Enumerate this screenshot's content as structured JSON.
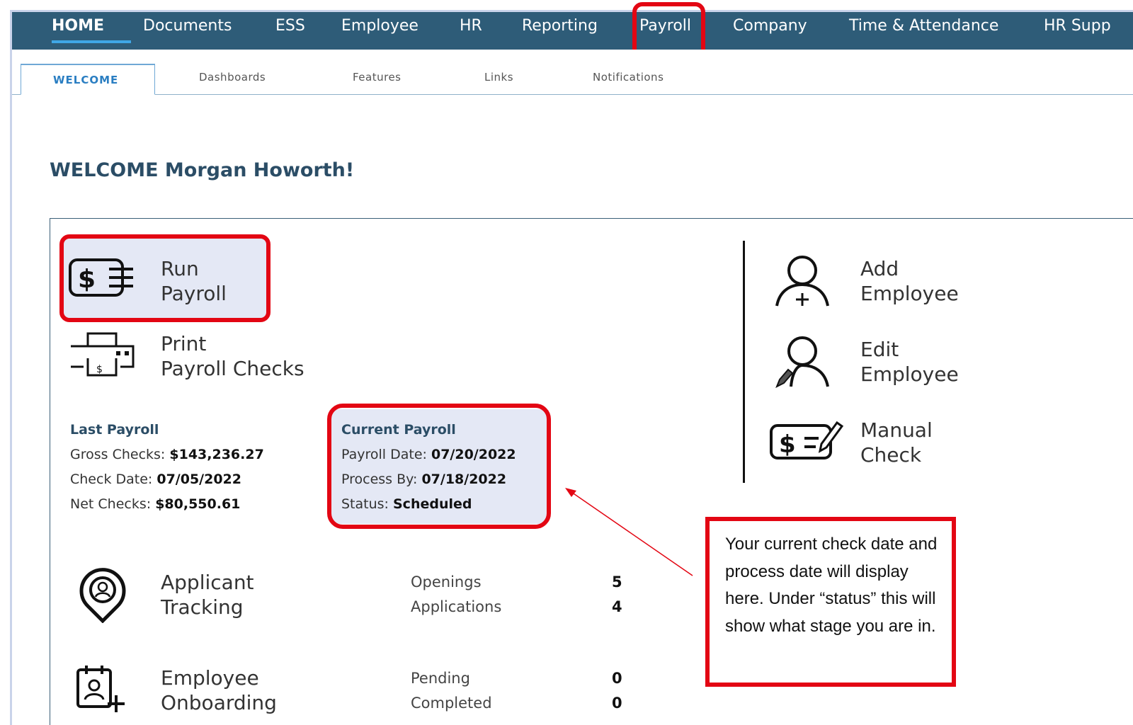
{
  "nav": {
    "items": [
      "HOME",
      "Documents",
      "ESS",
      "Employee",
      "HR",
      "Reporting",
      "Payroll",
      "Company",
      "Time & Attendance",
      "HR Supp"
    ]
  },
  "tabs": [
    "WELCOME",
    "Dashboards",
    "Features",
    "Links",
    "Notifications"
  ],
  "welcome": "WELCOME Morgan Howorth!",
  "actions": {
    "run_payroll": [
      "Run",
      "Payroll"
    ],
    "print_checks": [
      "Print",
      "Payroll Checks"
    ],
    "add_employee": [
      "Add",
      "Employee"
    ],
    "edit_employee": [
      "Edit",
      "Employee"
    ],
    "manual_check": [
      "Manual",
      "Check"
    ],
    "applicant_tracking": [
      "Applicant",
      "Tracking"
    ],
    "employee_onboarding": [
      "Employee",
      "Onboarding"
    ]
  },
  "last_payroll": {
    "title": "Last Payroll",
    "gross_label": "Gross Checks: ",
    "gross_value": "$143,236.27",
    "check_label": "Check Date: ",
    "check_value": "07/05/2022",
    "net_label": "Net Checks: ",
    "net_value": "$80,550.61"
  },
  "current_payroll": {
    "title": "Current Payroll",
    "date_label": "Payroll Date: ",
    "date_value": "07/20/2022",
    "process_label": "Process By: ",
    "process_value": "07/18/2022",
    "status_label": "Status: ",
    "status_value": "Scheduled"
  },
  "applicant_stats": {
    "openings_label": "Openings",
    "openings_value": "5",
    "applications_label": "Applications",
    "applications_value": "4"
  },
  "onboarding_stats": {
    "pending_label": "Pending",
    "pending_value": "0",
    "completed_label": "Completed",
    "completed_value": "0"
  },
  "callout": "Your current check date and process date will display here. Under “status” this will show what stage you are in.",
  "colors": {
    "nav_bg": "#2e5c78",
    "highlight_red": "#e30613",
    "tab_active": "#2a7ec2"
  }
}
